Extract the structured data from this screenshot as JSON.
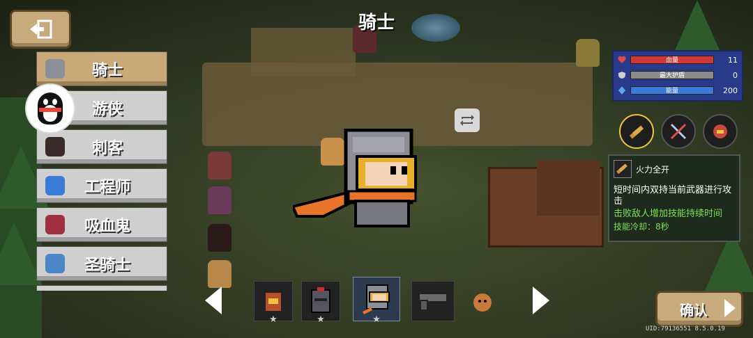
{
  "title": "骑士",
  "back_icon": "exit-icon",
  "characters": [
    {
      "label": "骑士",
      "selected": true,
      "avatar_color": "#8a8f9a"
    },
    {
      "label": "游侠",
      "selected": false,
      "avatar_color": "#6a7aa8"
    },
    {
      "label": "刺客",
      "selected": false,
      "avatar_color": "#3a2a2a"
    },
    {
      "label": "工程师",
      "selected": false,
      "avatar_color": "#3a7ad8"
    },
    {
      "label": "吸血鬼",
      "selected": false,
      "avatar_color": "#a03040"
    },
    {
      "label": "圣骑士",
      "selected": false,
      "avatar_color": "#4a86c8"
    }
  ],
  "stats": {
    "hp": {
      "label": "血量",
      "value": "11",
      "fraction": 1.0,
      "color": "#d03838"
    },
    "armor": {
      "label": "最大护盾",
      "value": "0",
      "fraction": 1.0,
      "color": "#8c8c8c"
    },
    "energy": {
      "label": "能量",
      "value": "200",
      "fraction": 1.0,
      "color": "#3a7ad8"
    }
  },
  "skills": [
    {
      "icon": "dual-wield-skill-icon",
      "selected": true
    },
    {
      "icon": "crossed-swords-skill-icon",
      "selected": false
    },
    {
      "icon": "helmet-skill-icon",
      "selected": false
    }
  ],
  "skill_tip": {
    "name": "火力全开",
    "desc": "短时间内双持当前武器进行攻击",
    "bonus": "击败敌人增加技能持续时间",
    "cooldown": "技能冷却：8秒"
  },
  "skins": [
    {
      "icon": "flame-knight-skin-icon",
      "selected": false
    },
    {
      "icon": "dark-knight-skin-icon",
      "selected": false
    },
    {
      "icon": "knight-skin-icon",
      "selected": true
    },
    {
      "icon": "gun-skin-icon",
      "selected": false
    },
    {
      "icon": "monkey-skin-icon",
      "selected": false
    }
  ],
  "confirm_label": "确认",
  "uid_text": "UID:79136551 8.5.0.19",
  "colors": {
    "accent_gold": "#c7ab7c",
    "selected_ring": "#f0c640"
  }
}
